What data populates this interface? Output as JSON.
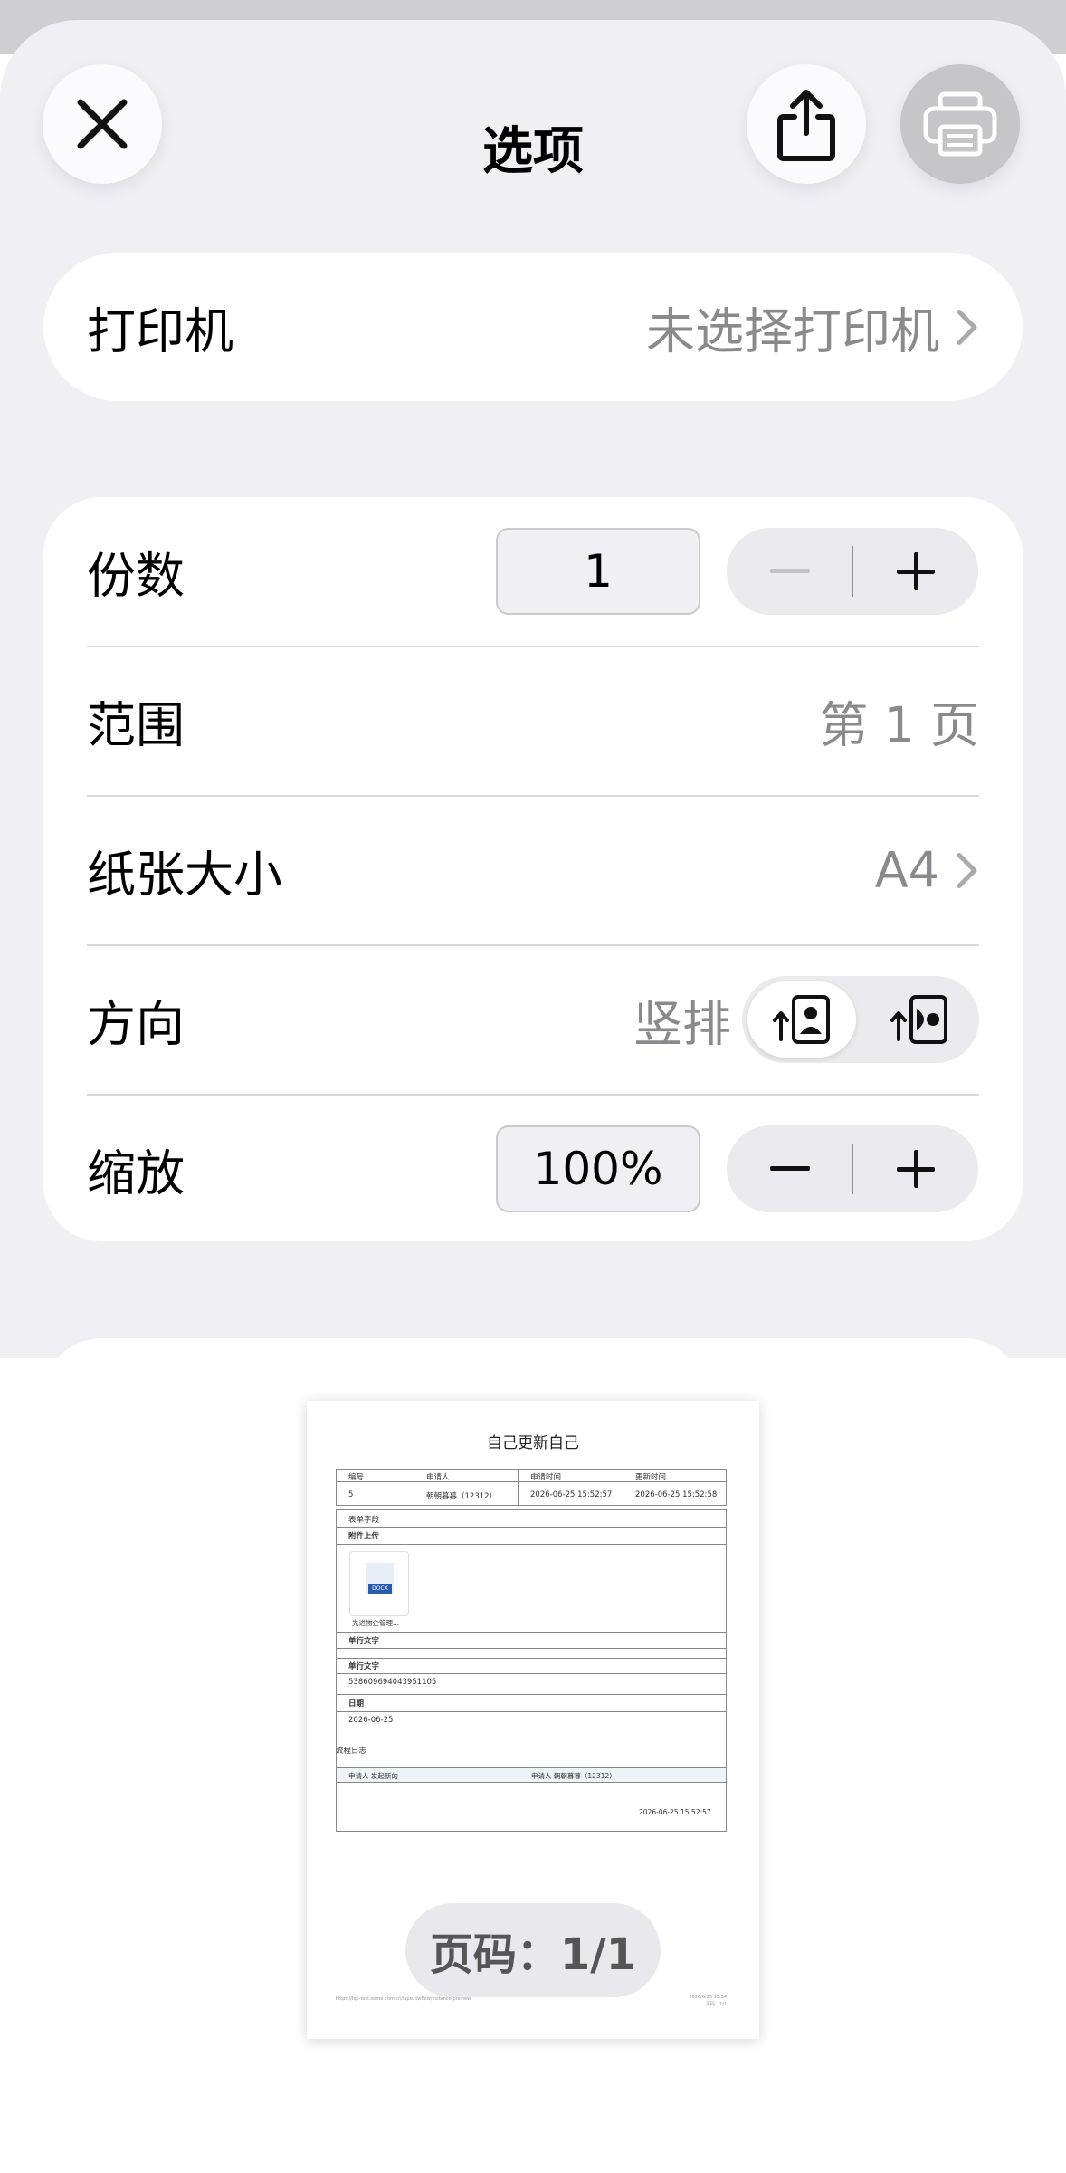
{
  "header": {
    "title": "选项",
    "close_icon": "close-icon",
    "share_icon": "share-icon",
    "print_icon": "printer-icon"
  },
  "printer": {
    "label": "打印机",
    "value": "未选择打印机"
  },
  "options": {
    "copies": {
      "label": "份数",
      "value": "1"
    },
    "range": {
      "label": "范围",
      "value": "第 1 页"
    },
    "paper_size": {
      "label": "纸张大小",
      "value": "A4"
    },
    "orientation": {
      "label": "方向",
      "value": "竖排",
      "selected": "portrait"
    },
    "scale": {
      "label": "缩放",
      "value": "100%"
    }
  },
  "preview": {
    "doc_title": "自己更新自己",
    "table_headers": [
      "编号",
      "申请人",
      "申请时间",
      "更新时间"
    ],
    "table_row": [
      "5",
      "朝朝暮暮（12312）",
      "2026-06-25 15:52:57",
      "2026-06-25 15:52:58"
    ],
    "field_single": "表单字段",
    "field_attach": "附件上传",
    "attachment_badge": "DOCX",
    "attachment_name": "先进物企管理...",
    "field_multiline": "单行文字",
    "field_single_text": "单行文字",
    "single_text_value": "538609694043951105",
    "field_date": "日期",
    "date_value": "2026-06-25",
    "log_title": "流程日志",
    "log_left": "申请人  发起新的",
    "log_right": "申请人  朝朝暮暮（12312）",
    "log_time": "2026-06-25 15:52:57",
    "footer_url": "https://bpi-test.some-com.cn/lapsui/wflow/instance-preview",
    "footer_date": "2026/6/25 15:54",
    "footer_page": "页码：1/1",
    "pager": "页码：1/1"
  },
  "colors": {
    "sheet_bg": "#efeff4",
    "card_bg": "#ffffff",
    "secondary_text": "#8a8a8e"
  }
}
